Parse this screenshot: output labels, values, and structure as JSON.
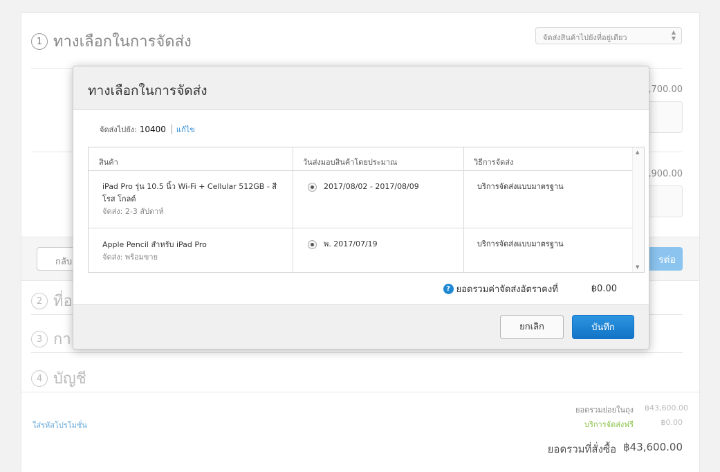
{
  "page": {
    "step1": {
      "num": "1",
      "title": "ทางเลือกในการจัดส่ง"
    },
    "delivery_select": "จัดส่งสินค้าไปยังที่อยู่เดียว",
    "item1_price_partial": "9,700.00",
    "item2_price_partial": "3,900.00",
    "back_button_partial": "กลับ",
    "continue_button_partial": "รต่อ",
    "step2": {
      "num": "2",
      "title_partial": "ที่อ"
    },
    "step3": {
      "num": "3",
      "title_partial": "กา"
    },
    "step4": {
      "num": "4",
      "title": "บัญชี"
    },
    "promo_link": "ใส่รหัสโปรโมชั่น",
    "summary": {
      "subtotal_label": "ยอดรวมย่อยในถุง",
      "subtotal_value": "฿43,600.00",
      "shipping_label": "บริการจัดส่งฟรี",
      "shipping_value": "฿0.00",
      "total_label": "ยอดรวมที่สั่งซื้อ",
      "total_value": "฿43,600.00"
    }
  },
  "modal": {
    "title": "ทางเลือกในการจัดส่ง",
    "ship_to_label": "จัดส่งไปยัง:",
    "ship_to_zip": "10400",
    "edit_link": "แก้ไข",
    "columns": [
      "สินค้า",
      "วันส่งมอบสินค้าโดยประมาณ",
      "วิธีการจัดส่ง"
    ],
    "rows": [
      {
        "product": "iPad Pro รุ่น 10.5 นิ้ว Wi-Fi + Cellular 512GB - สีโรส โกลด์",
        "shipping_note": "จัดส่ง: 2-3 สัปดาห์",
        "delivery_date": "2017/08/02 - 2017/08/09",
        "method": "บริการจัดส่งแบบมาตรฐาน"
      },
      {
        "product": "Apple Pencil สำหรับ iPad Pro",
        "shipping_note": "จัดส่ง: พร้อมขาย",
        "delivery_date": "พ. 2017/07/19",
        "method": "บริการจัดส่งแบบมาตรฐาน"
      }
    ],
    "total_label": "ยอดรวมค่าจัดส่งอัตราคงที่",
    "total_value": "฿0.00",
    "cancel_label": "ยกเลิก",
    "save_label": "บันทึก"
  },
  "icons": {
    "help": "question-circle-icon",
    "scroll_up": "triangle-up-icon",
    "scroll_down": "triangle-down-icon"
  },
  "colors": {
    "accent": "#1e88d2",
    "link": "#2a8ad4",
    "continue_disabled": "#8bc4ef",
    "shipping_free": "#8bc34a"
  }
}
